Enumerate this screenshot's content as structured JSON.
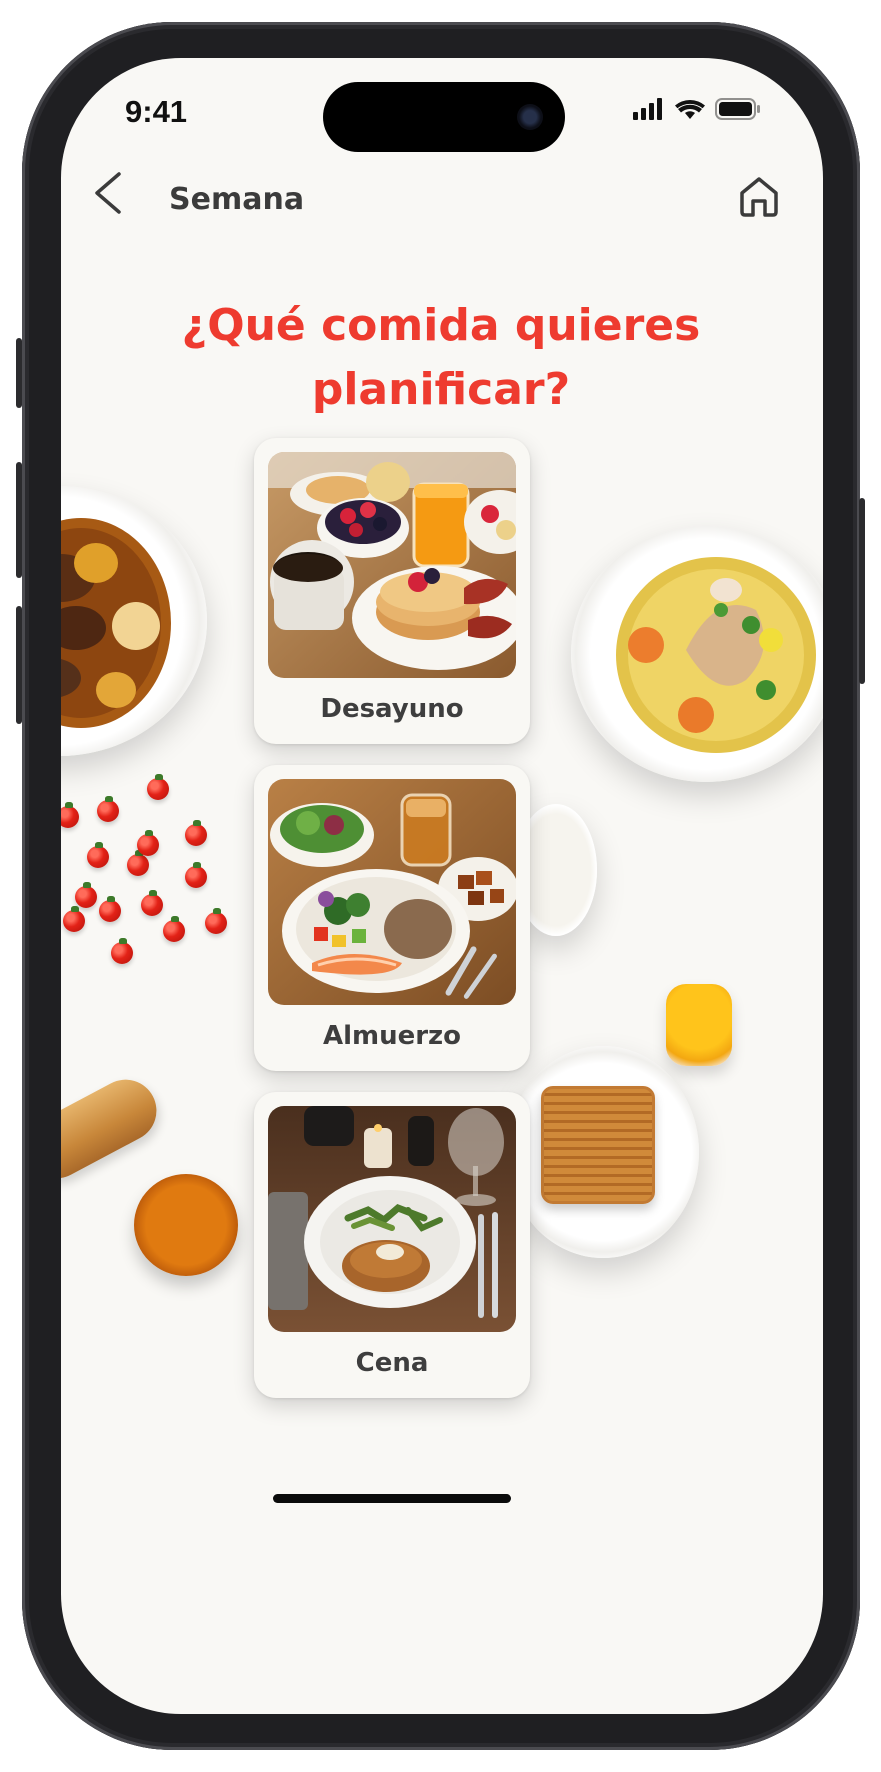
{
  "status_bar": {
    "time": "9:41"
  },
  "nav": {
    "title": "Semana",
    "back_icon": "chevron-left-icon",
    "home_icon": "home-icon"
  },
  "headline": "¿Qué comida quieres planificar?",
  "meals": [
    {
      "label": "Desayuno"
    },
    {
      "label": "Almuerzo"
    },
    {
      "label": "Cena"
    }
  ],
  "colors": {
    "accent": "#ee3b2f",
    "background": "#f9f8f5",
    "card": "#f9f8f4",
    "text": "#3e3e3e"
  }
}
